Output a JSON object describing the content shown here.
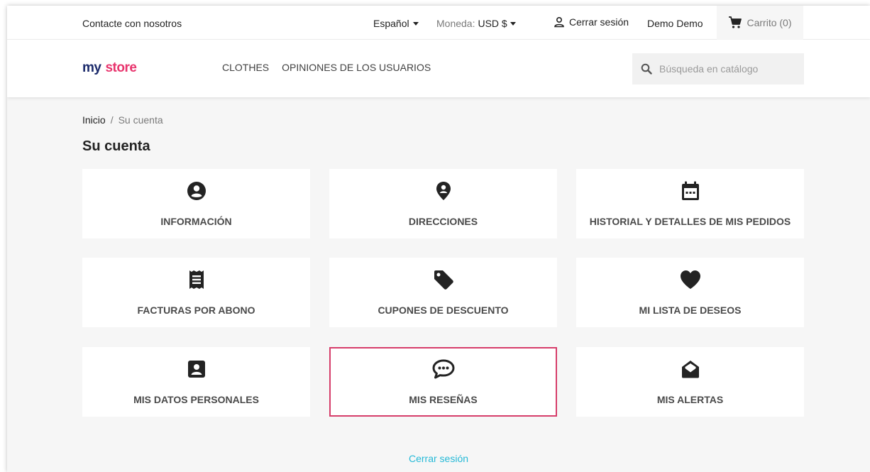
{
  "topbar": {
    "contact": "Contacte con nosotros",
    "language": "Español",
    "currency_label": "Moneda:",
    "currency_value": "USD $",
    "logout": "Cerrar sesión",
    "user_name": "Demo Demo",
    "cart": "Carrito (0)"
  },
  "header": {
    "logo_word1": "my",
    "logo_word2": "store",
    "nav": [
      "CLOTHES",
      "OPINIONES DE LOS USUARIOS"
    ],
    "search_placeholder": "Búsqueda en catálogo"
  },
  "breadcrumb": {
    "home": "Inicio",
    "separator": "/",
    "current": "Su cuenta"
  },
  "page_title": "Su cuenta",
  "tiles": [
    {
      "label": "INFORMACIÓN",
      "icon": "account-circle-icon"
    },
    {
      "label": "DIRECCIONES",
      "icon": "location-pin-icon"
    },
    {
      "label": "HISTORIAL Y DETALLES DE MIS PEDIDOS",
      "icon": "calendar-icon"
    },
    {
      "label": "FACTURAS POR ABONO",
      "icon": "receipt-icon"
    },
    {
      "label": "CUPONES DE DESCUENTO",
      "icon": "tag-icon"
    },
    {
      "label": "MI LISTA DE DESEOS",
      "icon": "heart-icon"
    },
    {
      "label": "MIS DATOS PERSONALES",
      "icon": "contact-card-icon"
    },
    {
      "label": "MIS RESEÑAS",
      "icon": "chat-bubble-icon"
    },
    {
      "label": "MIS ALERTAS",
      "icon": "open-envelope-icon"
    }
  ],
  "footer_logout": "Cerrar sesión",
  "colors": {
    "highlight_border": "#d63d6a",
    "link": "#24b9d7",
    "page_bg": "#f6f6f6"
  }
}
